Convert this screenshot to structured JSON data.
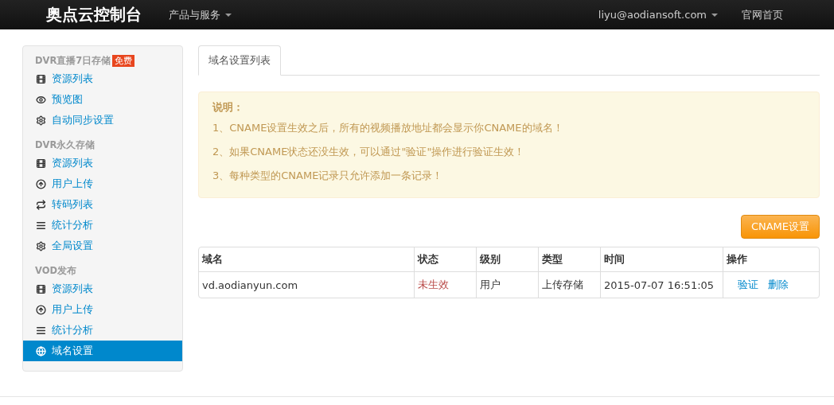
{
  "navbar": {
    "brand": "奥点云控制台",
    "menu": [
      {
        "label": "产品与服务",
        "dropdown": true
      }
    ],
    "right": [
      {
        "label": "liyu@aodiansoft.com",
        "dropdown": true
      },
      {
        "label": "官网首页",
        "dropdown": false
      }
    ]
  },
  "sidebar": {
    "sections": [
      {
        "title": "DVR直播7日存储",
        "badge": "免费",
        "items": [
          {
            "kind": "film",
            "label": "资源列表",
            "selected": false
          },
          {
            "kind": "eye",
            "label": "预览图",
            "selected": false
          },
          {
            "kind": "gear",
            "label": "自动同步设置",
            "selected": false
          }
        ]
      },
      {
        "title": "DVR永久存储",
        "items": [
          {
            "kind": "film",
            "label": "资源列表",
            "selected": false
          },
          {
            "kind": "upload",
            "label": "用户上传",
            "selected": false
          },
          {
            "kind": "repeat",
            "label": "转码列表",
            "selected": false
          },
          {
            "kind": "list",
            "label": "统计分析",
            "selected": false
          },
          {
            "kind": "gear",
            "label": "全局设置",
            "selected": false
          }
        ]
      },
      {
        "title": "VOD发布",
        "items": [
          {
            "kind": "film",
            "label": "资源列表",
            "selected": false
          },
          {
            "kind": "upload",
            "label": "用户上传",
            "selected": false
          },
          {
            "kind": "list",
            "label": "统计分析",
            "selected": false
          },
          {
            "kind": "globe",
            "label": "域名设置",
            "selected": true
          }
        ]
      }
    ]
  },
  "tabs": [
    {
      "label": "域名设置列表",
      "selected": true
    }
  ],
  "notice": {
    "title": "说明：",
    "lines": [
      "1、CNAME设置生效之后，所有的视频播放地址都会显示你CNAME的域名！",
      "2、如果CNAME状态还没生效，可以通过\"验证\"操作进行验证生效！",
      "3、每种类型的CNAME记录只允许添加一条记录！"
    ]
  },
  "button": "CNAME设置",
  "table": {
    "columns": [
      "域名",
      "状态",
      "级别",
      "类型",
      "时间",
      "操作"
    ],
    "rows": [
      {
        "domain": "vd.aodianyun.com",
        "status": "未生效",
        "level": "用户",
        "type": "上传存储",
        "time": "2015-07-07 16:51:05",
        "actions": [
          "验证",
          "删除"
        ]
      }
    ]
  }
}
